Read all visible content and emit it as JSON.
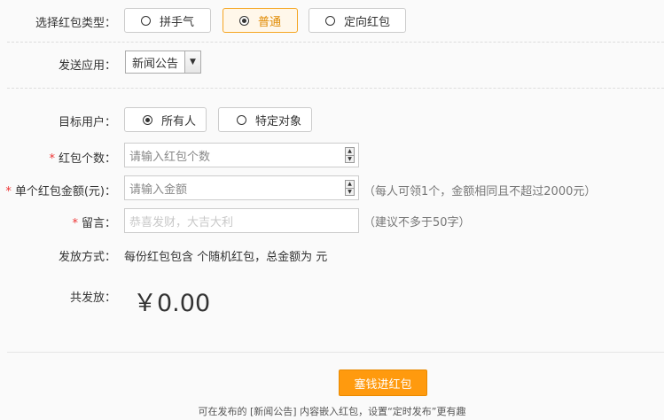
{
  "packet_type": {
    "label": "选择红包类型：",
    "options": [
      "拼手气",
      "普通",
      "定向红包"
    ],
    "selected": "普通"
  },
  "app": {
    "label": "发送应用：",
    "selected": "新闻公告"
  },
  "target": {
    "label": "目标用户：",
    "options": [
      "所有人",
      "特定对象"
    ],
    "selected": "所有人"
  },
  "count": {
    "label": "红包个数：",
    "placeholder": "请输入红包个数"
  },
  "amount": {
    "label": "单个红包金额(元)：",
    "placeholder": "请输入金额",
    "hint": "（每人可领1个，金额相同且不超过2000元）"
  },
  "message": {
    "label": "留言：",
    "placeholder": "恭喜发财，大吉大利",
    "hint": "（建议不多于50字）"
  },
  "method": {
    "label": "发放方式：",
    "text": "每份红包包含 个随机红包，总金额为 元"
  },
  "total": {
    "label": "共发放：",
    "value": "￥0.00"
  },
  "submit_label": "塞钱进红包",
  "footnote": "可在发布的 [新闻公告] 内容嵌入红包，设置“定时发布”更有趣",
  "colors": {
    "accent": "#ff9a0e",
    "required": "#ee3333"
  }
}
